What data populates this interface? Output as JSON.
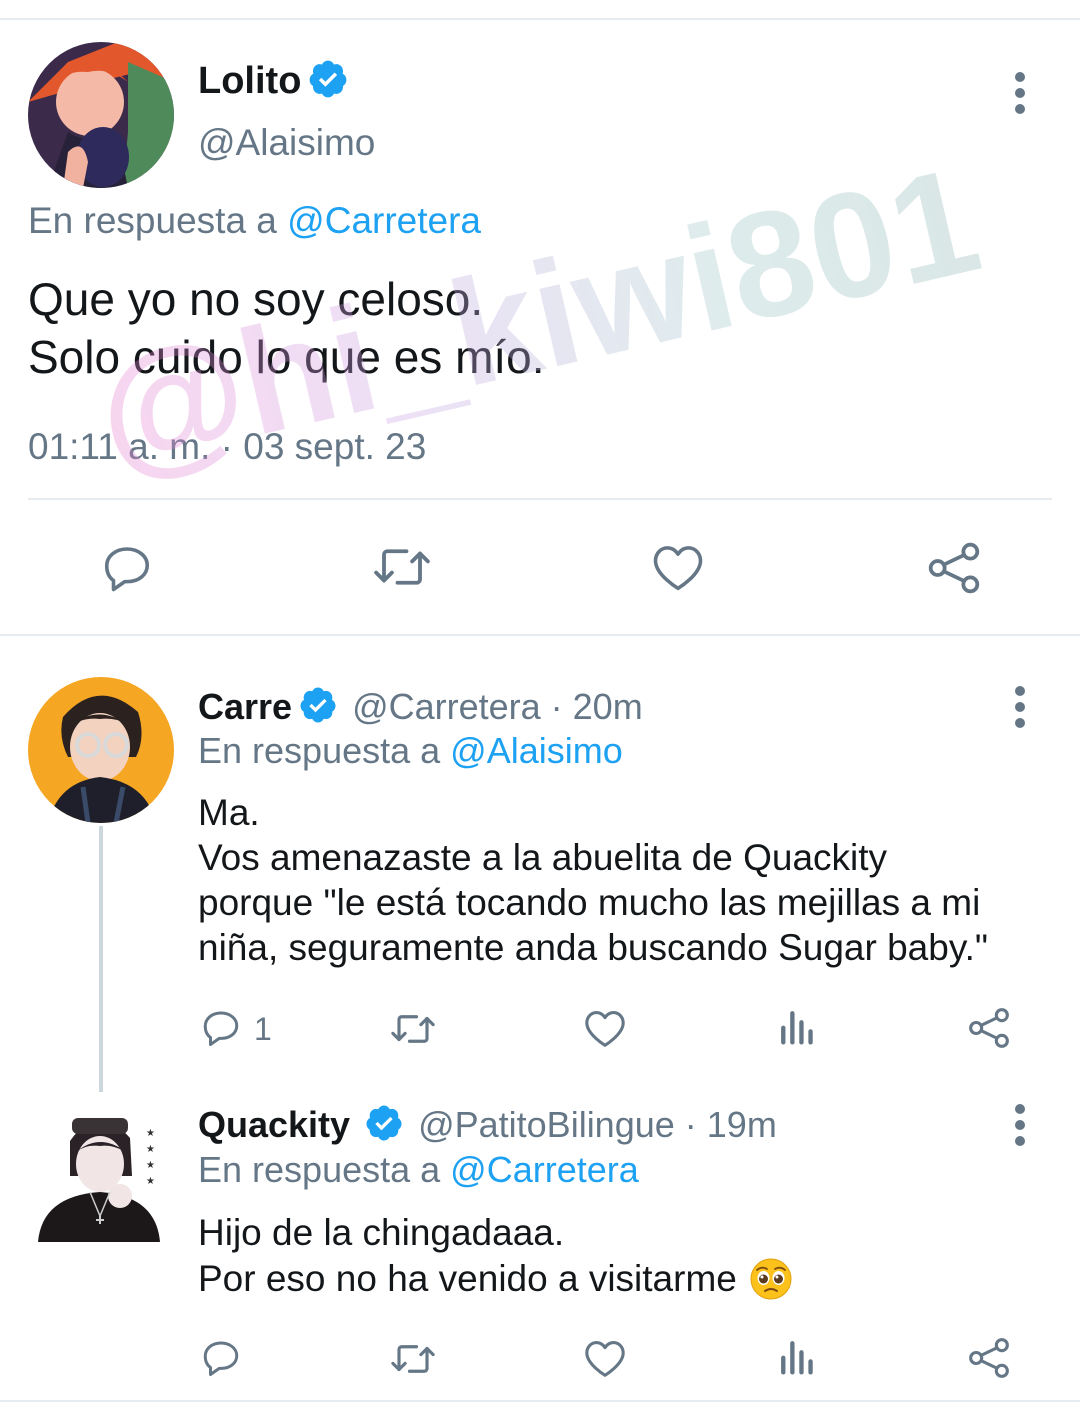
{
  "main_tweet": {
    "name": "Lolito",
    "handle": "@Alaisimo",
    "reply_prefix": "En respuesta a",
    "reply_to": "@Carretera",
    "text_lines": [
      "Que yo no soy celoso.",
      "Solo cuido lo que es mío."
    ],
    "timestamp": "01:11 a. m. · 03 sept. 23"
  },
  "replies": [
    {
      "name": "Carre",
      "handle": "@Carretera",
      "time": "· 20m",
      "reply_prefix": "En respuesta a",
      "reply_to": "@Alaisimo",
      "text": "Ma.\nVos amenazaste a la abuelita de Quackity\nporque \"le está tocando mucho las mejillas a mi\nniña, seguramente anda buscando Sugar baby.\"",
      "reply_count": "1"
    },
    {
      "name": "Quackity",
      "handle": "@PatitoBilingue",
      "time": "· 19m",
      "reply_prefix": "En respuesta a",
      "reply_to": "@Carretera",
      "text_line1": "Hijo de la chingadaaa.",
      "text_line2": "Por eso no ha venido a visitarme"
    }
  ],
  "watermark": "@hi_kiwi801",
  "icons": [
    "verified-badge-icon",
    "more-options-icon",
    "reply-icon",
    "retweet-icon",
    "like-icon",
    "share-icon",
    "analytics-icon",
    "pleading-face-emoji"
  ],
  "colors": {
    "accent": "#1da1f2",
    "muted": "#657786",
    "text": "#14171a",
    "divider": "#e6ecf0"
  }
}
